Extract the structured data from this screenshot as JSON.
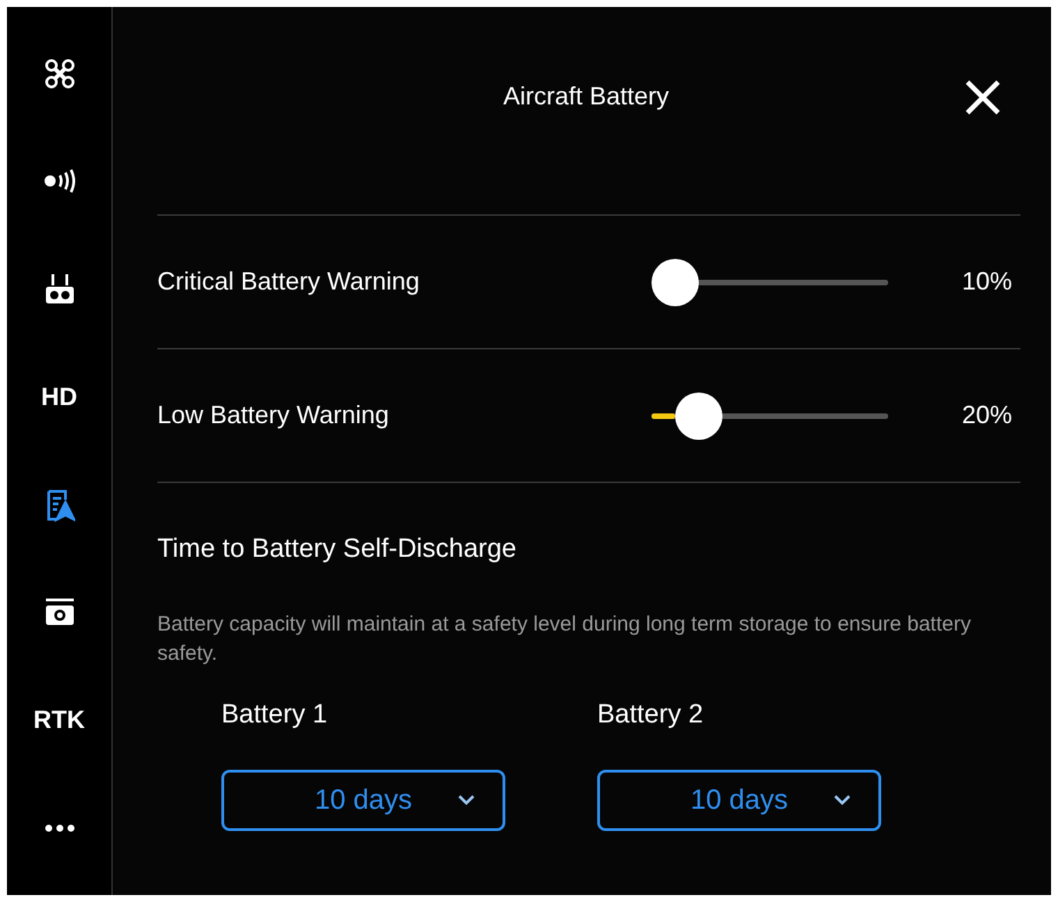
{
  "sidebar": {
    "items": [
      {
        "kind": "icon",
        "selected": false
      },
      {
        "kind": "icon",
        "selected": false
      },
      {
        "kind": "icon",
        "selected": false
      },
      {
        "kind": "text",
        "label": "HD",
        "selected": false
      },
      {
        "kind": "icon",
        "selected": true
      },
      {
        "kind": "icon",
        "selected": false
      },
      {
        "kind": "text",
        "label": "RTK",
        "selected": false
      },
      {
        "kind": "icon",
        "selected": false
      }
    ]
  },
  "panel": {
    "title": "Aircraft Battery",
    "sliders": [
      {
        "label": "Critical Battery Warning",
        "level": 0.1,
        "reading": "10%"
      },
      {
        "label": "Low Battery Warning",
        "level": 0.2,
        "reading": "20%"
      }
    ],
    "section_title": "Time to Battery Self-Discharge",
    "description": "Battery capacity will maintain at a safety level during long term storage to ensure battery safety.",
    "batteries": [
      {
        "label": "Battery 1",
        "value": "10 days"
      },
      {
        "label": "Battery 2",
        "value": "10 days"
      }
    ]
  }
}
